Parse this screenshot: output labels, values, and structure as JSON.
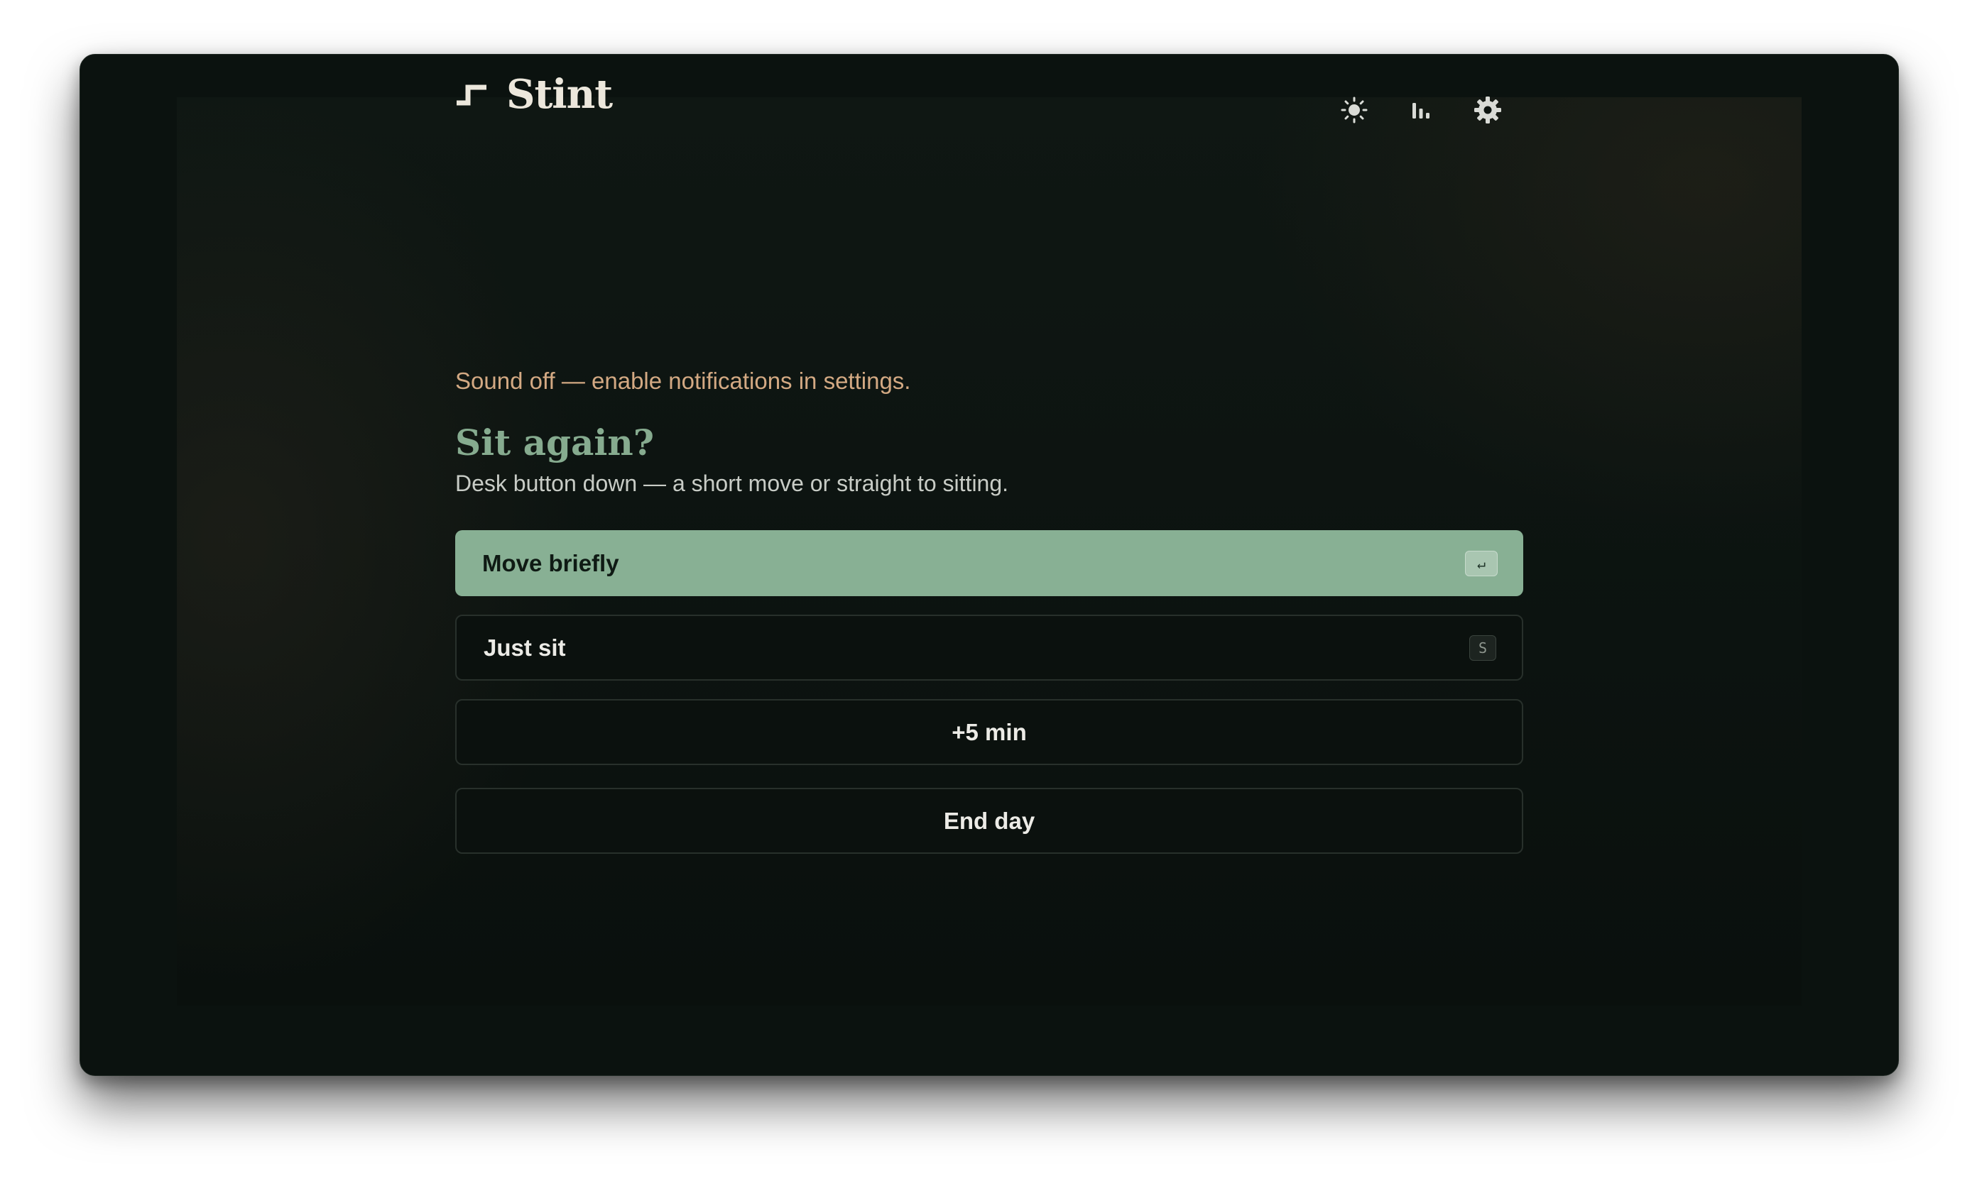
{
  "app": {
    "name": "Stint"
  },
  "toolbar": {
    "theme_icon": "sun-icon",
    "stats_icon": "bar-chart-icon",
    "settings_icon": "gear-icon"
  },
  "notice": {
    "text": "Sound off — enable notifications in settings."
  },
  "prompt": {
    "title": "Sit again?",
    "subtitle": "Desk button down — a short move or straight to sitting."
  },
  "options": {
    "move": {
      "label": "Move briefly",
      "shortcut": "↵"
    },
    "sit": {
      "label": "Just sit",
      "shortcut": "S"
    },
    "snooze": {
      "label": "+5 min"
    },
    "end": {
      "label": "End day"
    }
  },
  "colors": {
    "accent": "#88b094",
    "heading": "#86ab8f",
    "notice": "#d3a983",
    "background": "#0b120f"
  }
}
